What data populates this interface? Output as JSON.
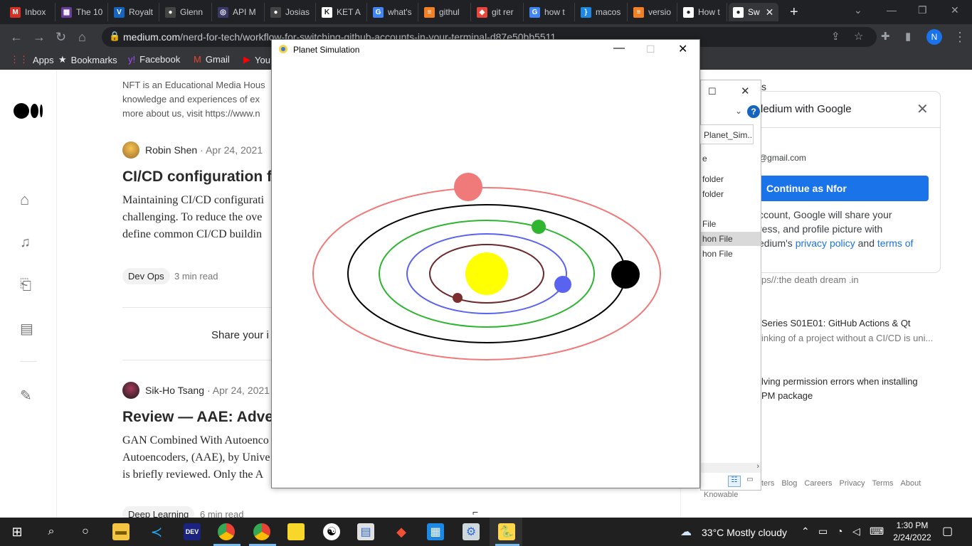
{
  "browser": {
    "tabs": [
      {
        "label": "Inbox",
        "icon": "gmail-icon",
        "color": "#d93025",
        "glyph": "M"
      },
      {
        "label": "The 10",
        "icon": "purple-site-icon",
        "color": "#6a3d9a",
        "glyph": "▦"
      },
      {
        "label": "Royalt",
        "icon": "v-icon",
        "color": "#1565c0",
        "glyph": "V"
      },
      {
        "label": "Glenn",
        "icon": "github-icon",
        "color": "#444444",
        "glyph": "●"
      },
      {
        "label": "API M",
        "icon": "api-icon",
        "color": "#3a3a6a",
        "glyph": "◎"
      },
      {
        "label": "Josias",
        "icon": "github-icon",
        "color": "#444444",
        "glyph": "●"
      },
      {
        "label": "KET A",
        "icon": "ket-icon",
        "color": "#ffffff",
        "glyph": "K"
      },
      {
        "label": "what's",
        "icon": "google-icon",
        "color": "#4285f4",
        "glyph": "G"
      },
      {
        "label": "githul",
        "icon": "stackoverflow-icon",
        "color": "#f48024",
        "glyph": "≡"
      },
      {
        "label": "git rer",
        "icon": "git-icon",
        "color": "#e8453c",
        "glyph": "◆"
      },
      {
        "label": "how t",
        "icon": "google-icon",
        "color": "#4285f4",
        "glyph": "G"
      },
      {
        "label": "macos",
        "icon": "bracket-icon",
        "color": "#1e88e5",
        "glyph": "}"
      },
      {
        "label": "versio",
        "icon": "stackoverflow-icon",
        "color": "#f48024",
        "glyph": "≡"
      },
      {
        "label": "How t",
        "icon": "medium-icon",
        "color": "#ffffff",
        "glyph": "●"
      },
      {
        "label": "Sw",
        "icon": "medium-icon",
        "color": "#ffffff",
        "glyph": "●",
        "active": true
      }
    ],
    "tab_close": "✕",
    "new_tab": "+",
    "url_domain": "medium.com",
    "url_path": "/nerd-for-tech/workflow-for-switching-github-accounts-in-your-terminal-d87e50bb5511",
    "profile_initial": "N",
    "bookmarks": [
      {
        "label": "Apps",
        "icon": "apps-grid-icon",
        "glyph": "⋮⋮"
      },
      {
        "label": "Bookmarks",
        "icon": "star-icon",
        "glyph": "★"
      },
      {
        "label": "Facebook",
        "icon": "yahoo-icon",
        "glyph": "y!"
      },
      {
        "label": "Gmail",
        "icon": "gmail-icon",
        "glyph": "M"
      },
      {
        "label": "You",
        "icon": "youtube-icon",
        "glyph": "▶"
      }
    ]
  },
  "medium": {
    "intro_lines": [
      "NFT is an Educational Media Hous",
      "knowledge and experiences of ex",
      "more about us, visit https://www.n"
    ],
    "post1": {
      "author": "Robin Shen",
      "date": "· Apr 24, 2021",
      "title": "CI/CD configuration f",
      "body": [
        "Maintaining CI/CD configurati",
        "challenging. To reduce the ove",
        "define common CI/CD buildin"
      ],
      "tag": "Dev Ops",
      "readtime": "3 min read"
    },
    "share_text": "Share your i",
    "post2": {
      "author": "Sik-Ho Tsang",
      "date": "· Apr 24, 2021",
      "title": "Review — AAE: Adve",
      "body": [
        "GAN Combined With Autoenco",
        "Autoencoders, (AAE), by Unive",
        "is briefly reviewed. Only the A"
      ],
      "tag": "Deep Learning",
      "readtime": "6 min read"
    },
    "right": {
      "s_letter": "s",
      "google_title": "ledium with Google",
      "google_email": "@gmail.com",
      "continue_btn": "Continue as Nfor",
      "consent_lines": [
        "ccount, Google will share your",
        "ress, and profile picture with",
        "edium's"
      ],
      "privacy_link": "privacy policy",
      "and_text": "and",
      "terms_link": "terms of",
      "link1": "ps//:the death dream .in",
      "rec1_title": "Series S01E01: GitHub Actions & Qt",
      "rec1_sub": "inking of a project without a CI/CD is uni...",
      "rec2_title_1": "lving permission errors when installing",
      "rec2_title_2": "PM package",
      "footer": [
        "ters",
        "Blog",
        "Careers",
        "Privacy",
        "Terms",
        "About"
      ],
      "footer2": "Knowable"
    }
  },
  "explorer": {
    "breadcrumb": "Planet_Sim...",
    "items": [
      "e",
      "folder",
      "folder",
      "",
      "File",
      "hon File",
      "hon File"
    ],
    "selected_index": 5
  },
  "pygame": {
    "title": "Planet Simulation",
    "sun_color": "#ffff00",
    "planets": [
      {
        "name": "mercury",
        "color": "#7a2e2e",
        "orbit": "#6b2a2a"
      },
      {
        "name": "venus",
        "color": "#5a62f0",
        "orbit": "#5a62f0"
      },
      {
        "name": "earth",
        "color": "#2fb52f",
        "orbit": "#2fb52f"
      },
      {
        "name": "mars",
        "color": "#000000",
        "orbit": "#000000"
      },
      {
        "name": "jupiter",
        "color": "#f07a7a",
        "orbit": "#f07a7a"
      }
    ]
  },
  "taskbar": {
    "weather": "33°C  Mostly cloudy",
    "time": "1:30 PM",
    "date": "2/24/2022"
  }
}
